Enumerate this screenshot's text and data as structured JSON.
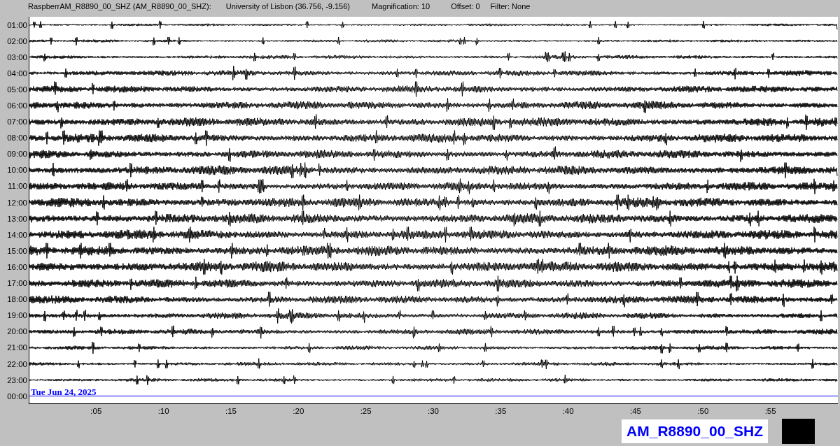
{
  "header": {
    "station": "RaspberrAM_R8890_00_SHZ (AM_R8890_00_SHZ):",
    "location": "University of Lisbon (36.756, -9.156)",
    "magnification": "Magnification: 10",
    "offset": "Offset: 0",
    "filter": "Filter: None"
  },
  "rows": [
    {
      "kind": "trace",
      "time": "01:00"
    },
    {
      "kind": "trace",
      "time": "02:00"
    },
    {
      "kind": "trace",
      "time": "03:00"
    },
    {
      "kind": "trace",
      "time": "04:00"
    },
    {
      "kind": "trace",
      "time": "05:00"
    },
    {
      "kind": "trace",
      "time": "06:00"
    },
    {
      "kind": "trace",
      "time": "07:00"
    },
    {
      "kind": "trace",
      "time": "08:00"
    },
    {
      "kind": "trace",
      "time": "09:00"
    },
    {
      "kind": "trace",
      "time": "10:00"
    },
    {
      "kind": "trace",
      "time": "11:00"
    },
    {
      "kind": "trace",
      "time": "12:00"
    },
    {
      "kind": "trace",
      "time": "13:00"
    },
    {
      "kind": "trace",
      "time": "14:00"
    },
    {
      "kind": "trace",
      "time": "15:00"
    },
    {
      "kind": "trace",
      "time": "16:00"
    },
    {
      "kind": "trace",
      "time": "17:00"
    },
    {
      "kind": "trace",
      "time": "18:00"
    },
    {
      "kind": "trace",
      "time": "19:00"
    },
    {
      "kind": "trace",
      "time": "20:00"
    },
    {
      "kind": "trace",
      "time": "21:00"
    },
    {
      "kind": "trace",
      "time": "22:00"
    },
    {
      "kind": "trace",
      "time": "23:00"
    },
    {
      "kind": "marker",
      "time": "00:00",
      "date": "Tue Jun 24, 2025"
    }
  ],
  "x_axis": {
    "ticks": [
      ":05",
      ":10",
      ":15",
      ":20",
      ":25",
      ":30",
      ":35",
      ":40",
      ":45",
      ":50",
      ":55"
    ]
  },
  "station_label": "AM_R8890_00_SHZ"
}
